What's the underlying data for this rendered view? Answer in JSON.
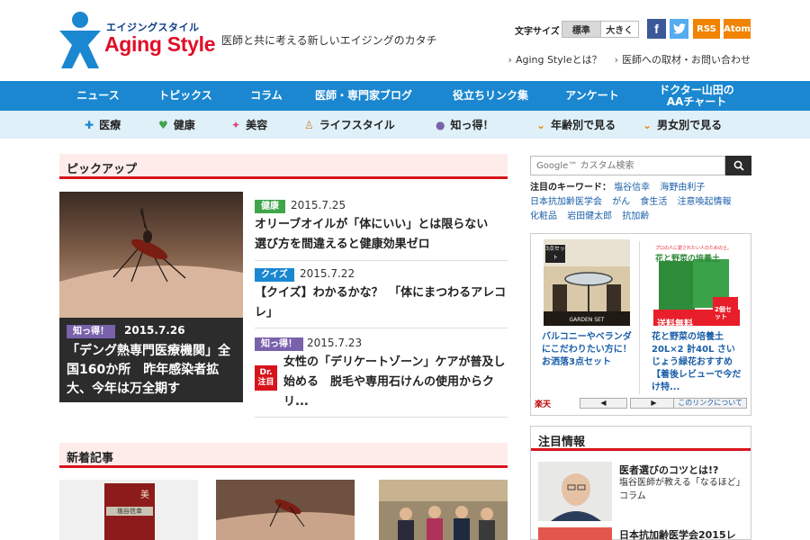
{
  "header": {
    "logo_kana": "エイジングスタイル",
    "logo_title": "Aging Style",
    "tagline": "医師と共に考える新しいエイジングのカタチ",
    "fontsize_label": "文字サイズ",
    "fontsize_standard": "標準",
    "fontsize_large": "大きく",
    "social": {
      "facebook": "f",
      "rss": "RSS",
      "atom": "Atom"
    },
    "util_links": [
      "Aging Styleとは？",
      "医師への取材・お問い合わせ"
    ]
  },
  "mainnav": [
    "ニュース",
    "トピックス",
    "コラム",
    "医師・専門家ブログ",
    "役立ちリンク集",
    "アンケート",
    "ドクター山田の",
    "AAチャート"
  ],
  "subnav": [
    "医療",
    "健康",
    "美容",
    "ライフスタイル",
    "知っ得！",
    "年齢別で見る",
    "男女別で見る"
  ],
  "colors": {
    "nav_blue": "#1a87d0",
    "accent_red": "#d7141c",
    "subnav_bg": "#dff0f8",
    "section_bg": "#fdecea"
  },
  "pickup": {
    "heading": "ピックアップ",
    "feature": {
      "badge": "知っ得！",
      "date": "2015.7.26",
      "title": "「デング熱専門医療機関」全国160か所　昨年感染者拡大、今年は万全期す"
    },
    "items": [
      {
        "badge": "健康",
        "date": "2015.7.25",
        "title": "オリーブオイルが「体にいい」とは限らない　選び方を間違えると健康効果ゼロ"
      },
      {
        "badge": "クイズ",
        "date": "2015.7.22",
        "title": "【クイズ】わかるかな？　「体にまつわるアレコレ」"
      },
      {
        "badge": "知っ得！",
        "date": "2015.7.23",
        "dr_badge_1": "Dr.",
        "dr_badge_2": "注目",
        "title": "女性の「デリケートゾーン」ケアが普及し始める　脱毛や専用石けんの使用からクリ..."
      }
    ]
  },
  "new_articles": {
    "heading": "新着記事",
    "book_title": "美",
    "book_author": "塩谷信幸"
  },
  "sidebar": {
    "search_placeholder": "Google™ カスタム検索",
    "keywords_label": "注目のキーワード：",
    "keywords": [
      "塩谷信幸",
      "海野由利子",
      "日本抗加齢医学会",
      "がん",
      "食生活",
      "注意喚起情報",
      "化粧品",
      "岩田健太郎",
      "抗加齢"
    ],
    "rakuten": {
      "item1_badge": "3点セット",
      "item1_caption": "GARDEN SET",
      "item1_text": "バルコニーやベランダにこだわりたい方に！お洒落3点セット",
      "item2_top": "プロの人に愛されたい人のための土。",
      "item2_title": "花と野菜の培養土",
      "item2_banner": "送料無料",
      "item2_corner": "2個セット",
      "item2_text": "花と野菜の培養土　20L×2 計40L さいじょう緑花おすすめ【着後レビューで今だけ特...",
      "logo": "楽天",
      "prev": "◀",
      "next": "▶",
      "about": "このリンクについて"
    },
    "info": {
      "heading": "注目情報",
      "title": "医者選びのコツとは!?",
      "sub1": "塩谷医師が教える「なるほど」",
      "sub2": "コラム",
      "title2": "日本抗加齢医学会2015レ"
    }
  }
}
